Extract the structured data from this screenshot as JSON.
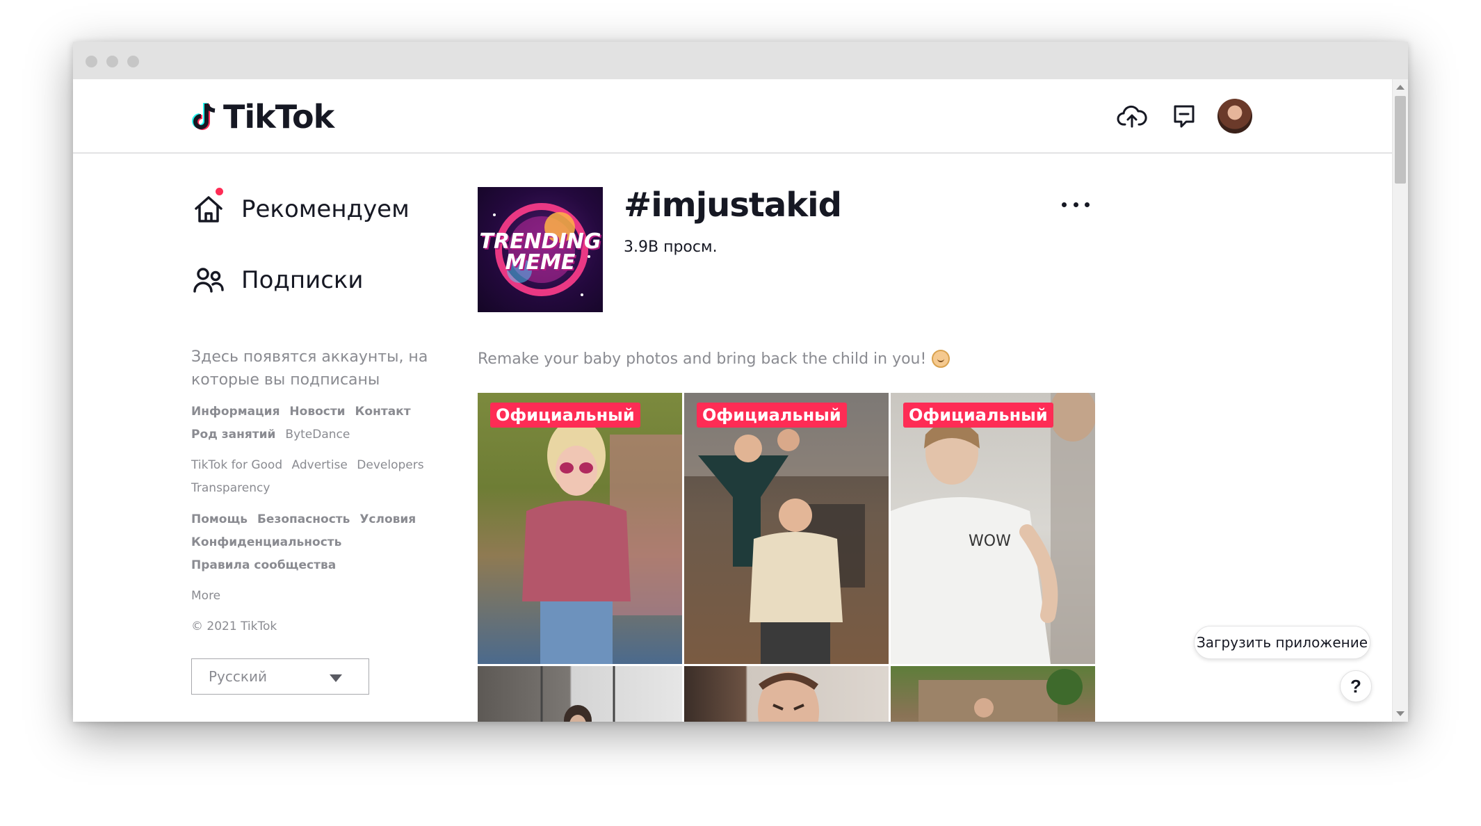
{
  "header": {
    "logo_text": "TikTok",
    "upload_icon": "cloud-upload-icon",
    "inbox_icon": "message-icon",
    "avatar": "user-avatar"
  },
  "sidebar": {
    "nav": [
      {
        "label": "Рекомендуем",
        "icon": "home-icon",
        "has_notification_dot": true
      },
      {
        "label": "Подписки",
        "icon": "users-icon"
      }
    ],
    "follow_hint": "Здесь появятся аккаунты, на которые вы подписаны",
    "links_group_1": [
      "Информация",
      "Новости",
      "Контакт",
      "Род занятий",
      "ByteDance"
    ],
    "links_group_2": [
      "TikTok for Good",
      "Advertise",
      "Developers",
      "Transparency"
    ],
    "links_group_3": [
      "Помощь",
      "Безопасность",
      "Условия",
      "Конфиденциальность",
      "Правила сообщества"
    ],
    "more": "More",
    "copyright": "© 2021 TikTok",
    "language": "Русский"
  },
  "hashtag": {
    "cover_text_1": "TRENDING",
    "cover_text_2": "MEME",
    "title": "#imjustakid",
    "views": "3.9B просм.",
    "description": "Remake your baby photos and bring back the child in you!",
    "description_emoji": "baby-emoji"
  },
  "videos": [
    {
      "badge": "Официальный"
    },
    {
      "badge": "Официальный"
    },
    {
      "badge": "Официальный"
    },
    {
      "badge": ""
    },
    {
      "badge": ""
    },
    {
      "badge": ""
    }
  ],
  "floating": {
    "get_app": "Загрузить приложение",
    "help": "?"
  },
  "colors": {
    "brand_red": "#fe2c55",
    "text_primary": "#161823",
    "text_secondary": "#8a8b91"
  }
}
